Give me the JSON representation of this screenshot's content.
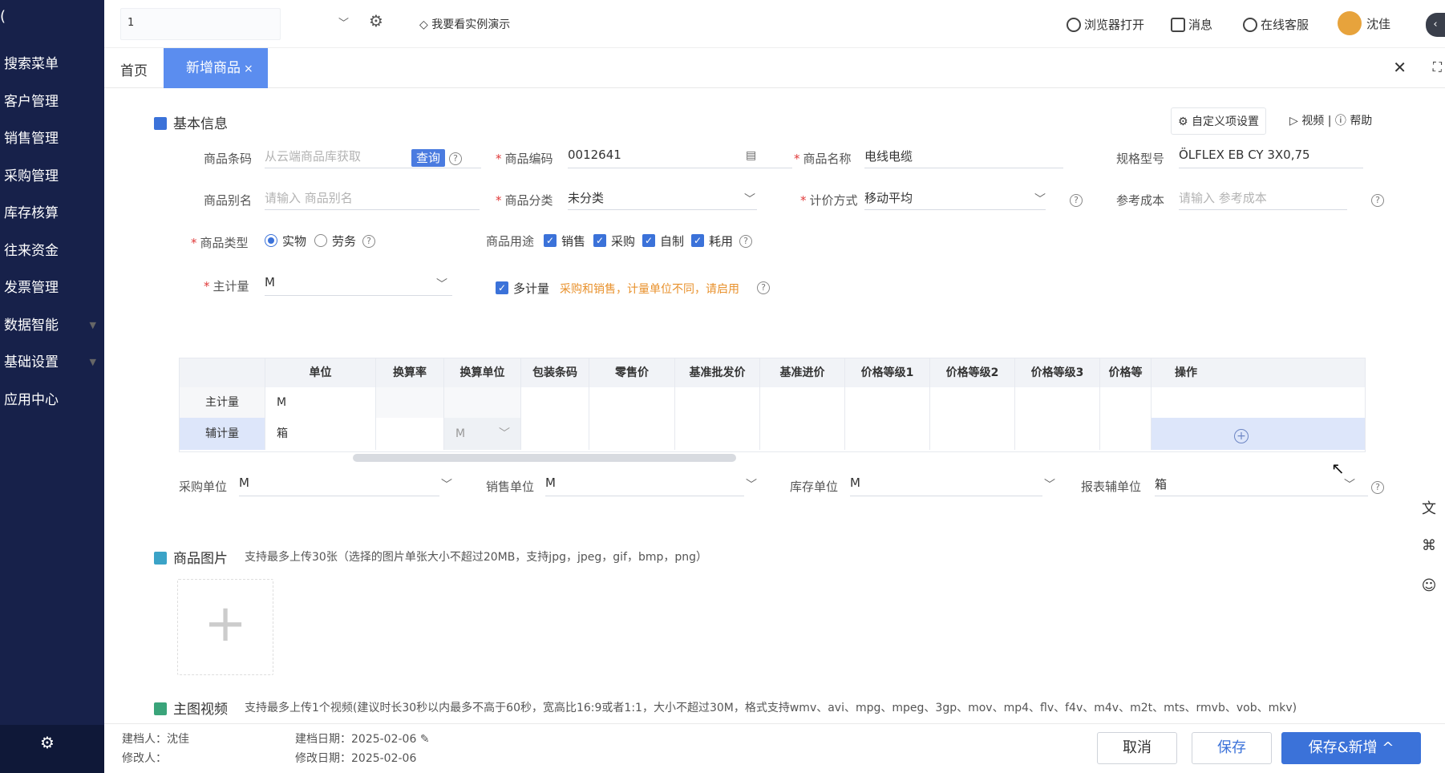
{
  "sidebar": {
    "items": [
      {
        "label": "搜索菜单",
        "caret": ""
      },
      {
        "label": "客户管理",
        "caret": ""
      },
      {
        "label": "销售管理",
        "caret": ""
      },
      {
        "label": "采购管理",
        "caret": ""
      },
      {
        "label": "库存核算",
        "caret": ""
      },
      {
        "label": "往来资金",
        "caret": ""
      },
      {
        "label": "发票管理",
        "caret": ""
      },
      {
        "label": "数据智能",
        "caret": "▼"
      },
      {
        "label": "基础设置",
        "caret": "▼"
      },
      {
        "label": "应用中心",
        "caret": ""
      }
    ]
  },
  "topbar": {
    "selector_value": "1",
    "demo": "我要看实例演示",
    "browser_open": "浏览器打开",
    "messages": "消息",
    "online_service": "在线客服",
    "user": "沈佳"
  },
  "tabs": {
    "home": "首页",
    "active": "新增商品",
    "active_close": "×"
  },
  "basic": {
    "title": "基本信息",
    "custom_settings": "自定义项设置",
    "video": "视频",
    "divider": "|",
    "help": "帮助",
    "barcode_label": "商品条码",
    "barcode_placeholder": "从云端商品库获取",
    "query": "查询",
    "code_label": "商品编码",
    "code_value": "0012641",
    "name_label": "商品名称",
    "name_value": "电线电缆",
    "spec_label": "规格型号",
    "spec_value": "ÖLFLEX EB CY 3X0,75",
    "alias_label": "商品别名",
    "alias_placeholder": "请输入 商品别名",
    "category_label": "商品分类",
    "category_value": "未分类",
    "pricing_label": "计价方式",
    "pricing_value": "移动平均",
    "ref_cost_label": "参考成本",
    "ref_cost_placeholder": "请输入 参考成本",
    "type_label": "商品类型",
    "type_options": [
      "实物",
      "劳务"
    ],
    "usage_label": "商品用途",
    "usage_options": [
      "销售",
      "采购",
      "自制",
      "耗用"
    ],
    "main_unit_label": "主计量",
    "main_unit_value": "M",
    "multi_unit_label": "多计量",
    "multi_unit_hint": "采购和销售，计量单位不同，请启用"
  },
  "unit_table": {
    "headers": [
      "",
      "单位",
      "换算率",
      "换算单位",
      "包装条码",
      "零售价",
      "基准批发价",
      "基准进价",
      "价格等级1",
      "价格等级2",
      "价格等级3",
      "价格等",
      "操作"
    ],
    "rows": [
      [
        "主计量",
        "M",
        "",
        "",
        "",
        "",
        "",
        "",
        "",
        "",
        "",
        "",
        ""
      ],
      [
        "辅计量",
        "箱",
        "",
        "M",
        "",
        "",
        "",
        "",
        "",
        "",
        "",
        "",
        ""
      ]
    ]
  },
  "units_row": {
    "purchase_label": "采购单位",
    "purchase_value": "M",
    "sales_label": "销售单位",
    "sales_value": "M",
    "stock_label": "库存单位",
    "stock_value": "M",
    "report_label": "报表辅单位",
    "report_value": "箱"
  },
  "images": {
    "title": "商品图片",
    "hint": "支持最多上传30张（选择的图片单张大小不超过20MB，支持jpg，jpeg，gif，bmp，png）",
    "add": "+"
  },
  "video": {
    "title": "主图视频",
    "hint": "支持最多上传1个视频(建议时长30秒以内最多不高于60秒，宽高比16:9或者1:1，大小不超过30M，格式支持wmv、avi、mpg、mpeg、3gp、mov、mp4、flv、f4v、m4v、m2t、mts、rmvb、vob、mkv)"
  },
  "footer": {
    "creator": "建档人：沈佳",
    "modifier": "修改人：",
    "created_date": "建档日期：2025-02-06",
    "modified_date": "修改日期：2025-02-06",
    "cancel": "取消",
    "save": "保存",
    "save_new": "保存&新增 ^"
  }
}
